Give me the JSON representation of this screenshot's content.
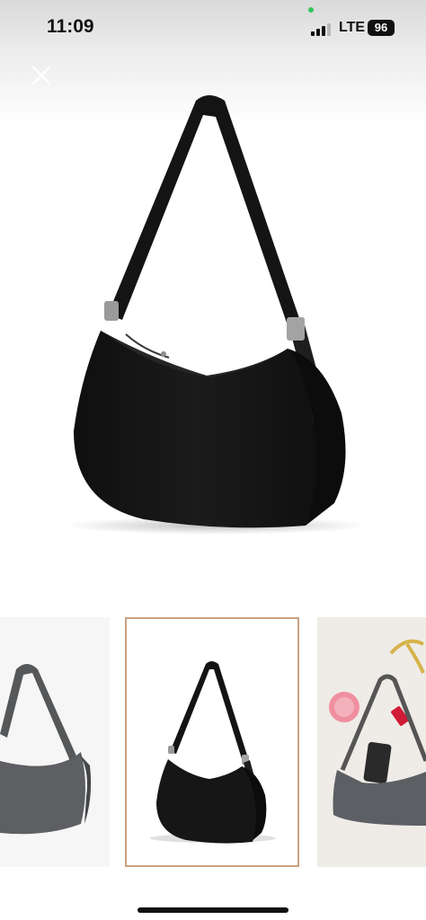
{
  "status_bar": {
    "time": "11:09",
    "network": "LTE",
    "battery": "96"
  },
  "icons": {
    "close": "close-icon",
    "signal": "signal-icon"
  },
  "colors": {
    "selected_border": "#c9a27e",
    "bag_black": "#151515",
    "bag_grey": "#5d5f63"
  },
  "gallery": {
    "thumbnails": [
      {
        "color": "grey",
        "selected": false
      },
      {
        "color": "black",
        "selected": true
      },
      {
        "color": "grey",
        "selected": false
      }
    ]
  }
}
